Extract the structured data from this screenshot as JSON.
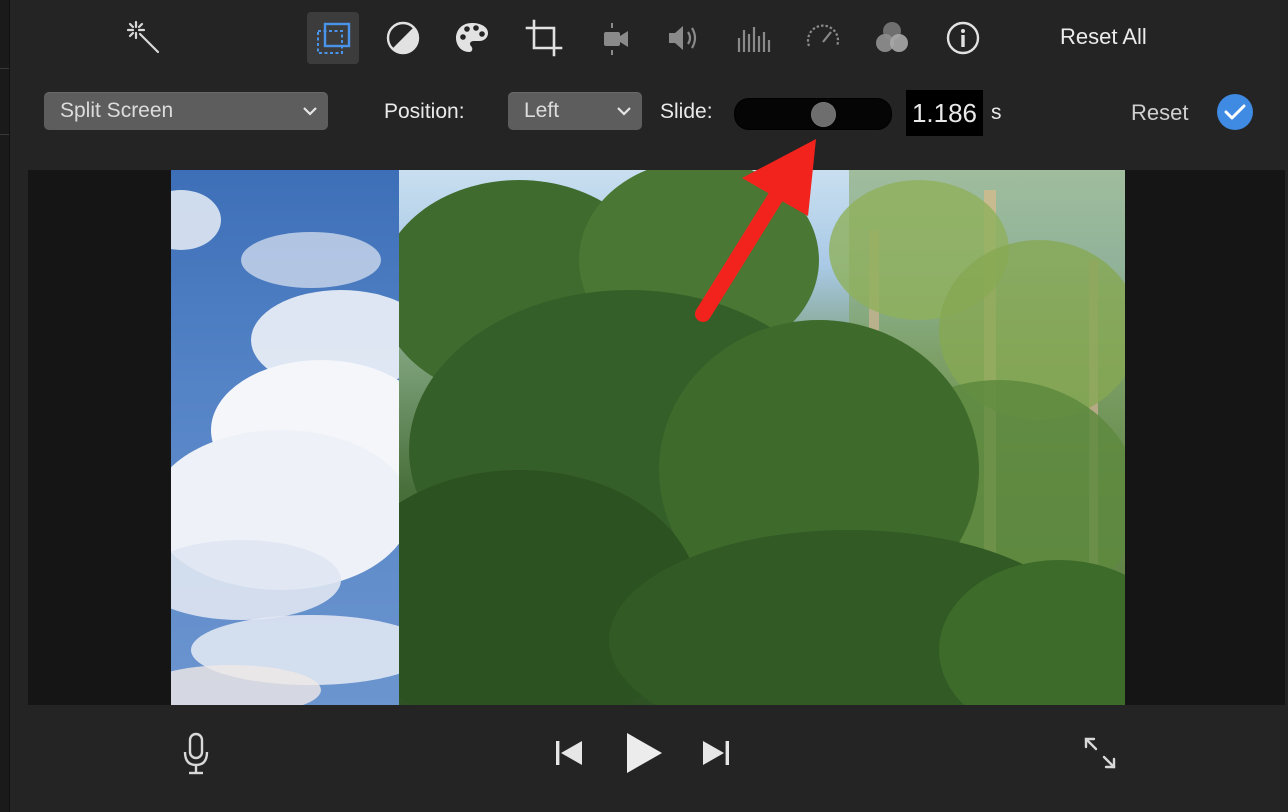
{
  "toolbar": {
    "tools": [
      {
        "name": "magic-wand-icon"
      },
      {
        "name": "video-overlay-icon",
        "active": true
      },
      {
        "name": "color-balance-icon"
      },
      {
        "name": "color-palette-icon"
      },
      {
        "name": "crop-icon"
      },
      {
        "name": "stabilization-icon"
      },
      {
        "name": "volume-icon"
      },
      {
        "name": "equalizer-icon"
      },
      {
        "name": "speed-gauge-icon"
      },
      {
        "name": "filters-icon"
      },
      {
        "name": "info-icon"
      }
    ],
    "reset_all_label": "Reset All"
  },
  "controls": {
    "overlay_style": "Split Screen",
    "position_label": "Position:",
    "position_value": "Left",
    "slide_label": "Slide:",
    "slide_fraction": 0.58,
    "slide_value": "1.186",
    "slide_unit": "s",
    "reset_label": "Reset"
  },
  "colors": {
    "accent": "#3f8ae2",
    "annotation_arrow": "#f2231c",
    "background": "#242424"
  },
  "bottom_bar": {
    "icons": [
      "microphone-icon",
      "skip-back-icon",
      "play-icon",
      "skip-forward-icon",
      "fullscreen-icon"
    ]
  }
}
